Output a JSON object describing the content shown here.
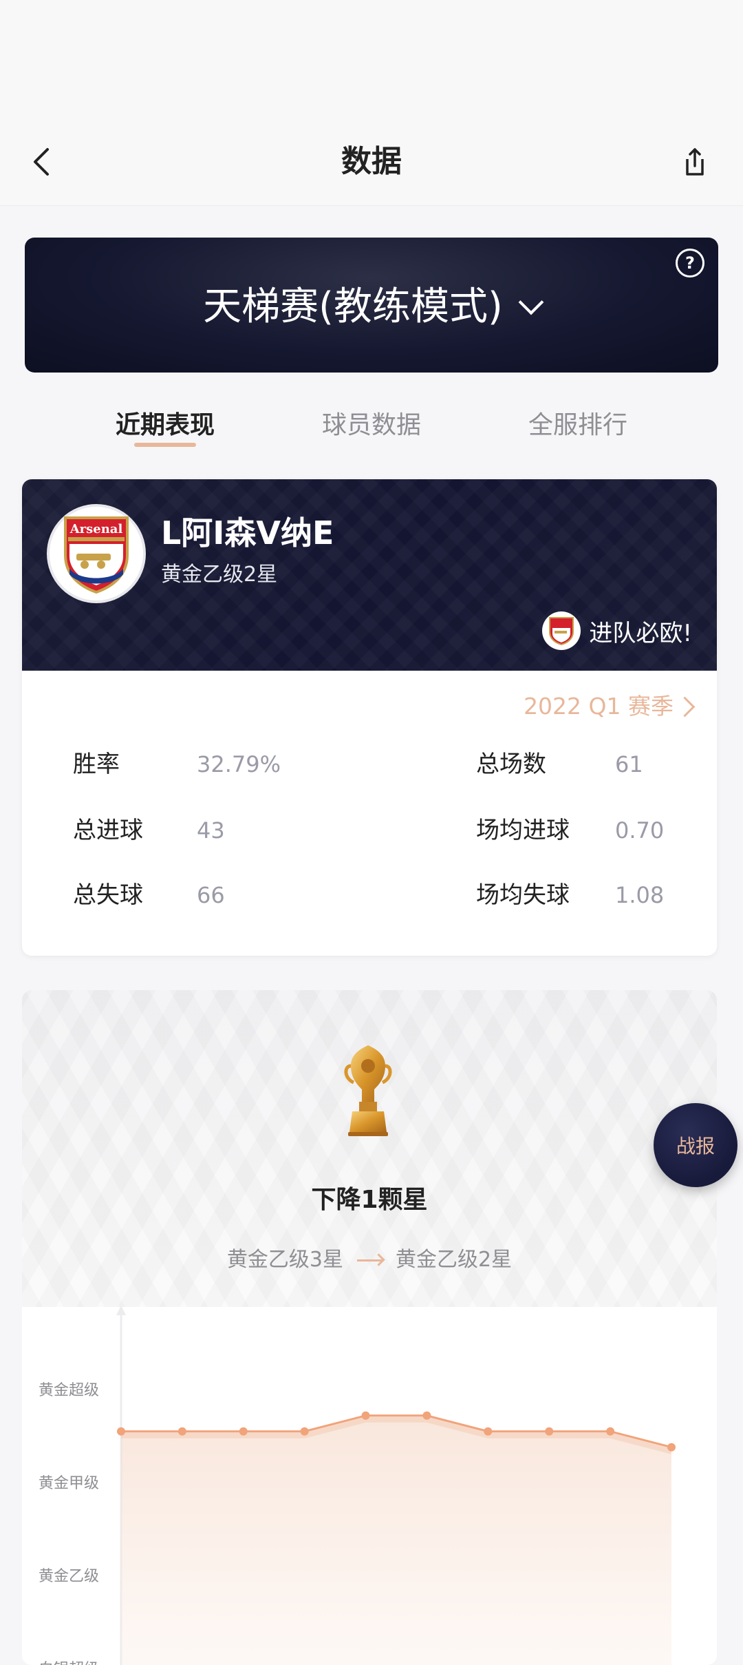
{
  "header": {
    "title": "数据"
  },
  "mode": {
    "title": "天梯赛(教练模式)"
  },
  "tabs": [
    {
      "label": "近期表现",
      "active": true
    },
    {
      "label": "球员数据",
      "active": false
    },
    {
      "label": "全服排行",
      "active": false
    }
  ],
  "player": {
    "name": "L阿I森V纳E",
    "rank": "黄金乙级2星",
    "motto": "进队必欧!",
    "club_logo_text": "Arsenal"
  },
  "season": {
    "label": "2022 Q1 赛季"
  },
  "stats": {
    "win_rate": {
      "label": "胜率",
      "value": "32.79%"
    },
    "total_games": {
      "label": "总场数",
      "value": "61"
    },
    "goals_for": {
      "label": "总进球",
      "value": "43"
    },
    "avg_goals_for": {
      "label": "场均进球",
      "value": "0.70"
    },
    "goals_against": {
      "label": "总失球",
      "value": "66"
    },
    "avg_goals_against": {
      "label": "场均失球",
      "value": "1.08"
    }
  },
  "rank_change": {
    "title": "下降1颗星",
    "from": "黄金乙级3星",
    "to": "黄金乙级2星"
  },
  "chart_data": {
    "type": "area",
    "y_categories": [
      "黄金超级",
      "黄金甲级",
      "黄金乙级",
      "白银超级"
    ],
    "values": [
      2.55,
      2.55,
      2.55,
      2.55,
      2.72,
      2.72,
      2.55,
      2.55,
      2.55,
      2.38
    ],
    "title": "",
    "xlabel": "",
    "ylabel": ""
  },
  "fab": {
    "label": "战报"
  },
  "colors": {
    "accent": "#e8b79a",
    "line": "#f1a37a",
    "dark": "#151830"
  },
  "icons": {
    "back": "chevron-left-icon",
    "share": "share-icon",
    "help": "help-icon",
    "dropdown": "chevron-down-icon"
  }
}
